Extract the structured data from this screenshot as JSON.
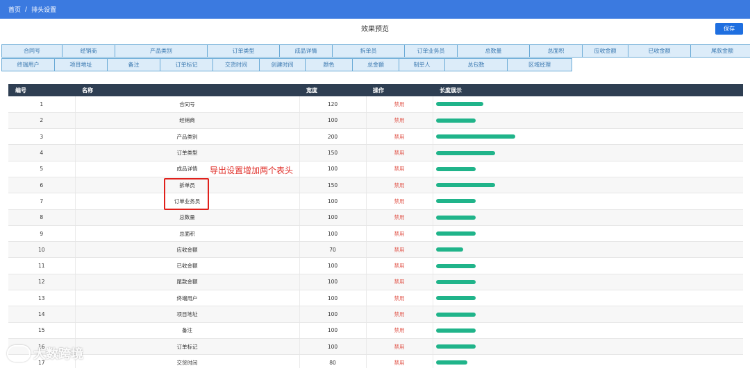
{
  "breadcrumb": {
    "home": "首页",
    "sep": "/",
    "current": "排头设置"
  },
  "preview_title": "效果预览",
  "save_label": "保存",
  "header_row1": [
    "合同号",
    "经销商",
    "产品类别",
    "订单类型",
    "成品详情",
    "拆单员",
    "订单业务员",
    "总数量",
    "总面积",
    "应收金额",
    "已收金额",
    "尾款金额"
  ],
  "header_row2": [
    "终端用户",
    "项目地址",
    "备注",
    "订单标记",
    "交货时间",
    "创建时间",
    "颜色",
    "总金额",
    "制单人",
    "总包数",
    "区域经理"
  ],
  "table": {
    "columns": [
      "编号",
      "名称",
      "宽度",
      "操作",
      "长度展示"
    ],
    "rows": [
      {
        "id": "1",
        "name": "合同号",
        "width": 120,
        "op": "禁用"
      },
      {
        "id": "2",
        "name": "经销商",
        "width": 100,
        "op": "禁用"
      },
      {
        "id": "3",
        "name": "产品类别",
        "width": 200,
        "op": "禁用"
      },
      {
        "id": "4",
        "name": "订单类型",
        "width": 150,
        "op": "禁用"
      },
      {
        "id": "5",
        "name": "成品详情",
        "width": 100,
        "op": "禁用"
      },
      {
        "id": "6",
        "name": "拆单员",
        "width": 150,
        "op": "禁用"
      },
      {
        "id": "7",
        "name": "订单业务员",
        "width": 100,
        "op": "禁用"
      },
      {
        "id": "8",
        "name": "总数量",
        "width": 100,
        "op": "禁用"
      },
      {
        "id": "9",
        "name": "总面积",
        "width": 100,
        "op": "禁用"
      },
      {
        "id": "10",
        "name": "应收金额",
        "width": 70,
        "op": "禁用"
      },
      {
        "id": "11",
        "name": "已收金额",
        "width": 100,
        "op": "禁用"
      },
      {
        "id": "12",
        "name": "尾款金额",
        "width": 100,
        "op": "禁用"
      },
      {
        "id": "13",
        "name": "终端用户",
        "width": 100,
        "op": "禁用"
      },
      {
        "id": "14",
        "name": "项目地址",
        "width": 100,
        "op": "禁用"
      },
      {
        "id": "15",
        "name": "备注",
        "width": 100,
        "op": "禁用"
      },
      {
        "id": "16",
        "name": "订单标记",
        "width": 100,
        "op": "禁用"
      },
      {
        "id": "17",
        "name": "交货时间",
        "width": 80,
        "op": "禁用"
      }
    ]
  },
  "annotation": "导出设置增加两个表头",
  "watermark": "大数跨境",
  "colors": {
    "topbar": "#3b7ae0",
    "save": "#1f6fe0",
    "table_header": "#2e3e52",
    "bar": "#20b48a",
    "disabled": "#e25a4f",
    "annotation": "#e0302a"
  }
}
